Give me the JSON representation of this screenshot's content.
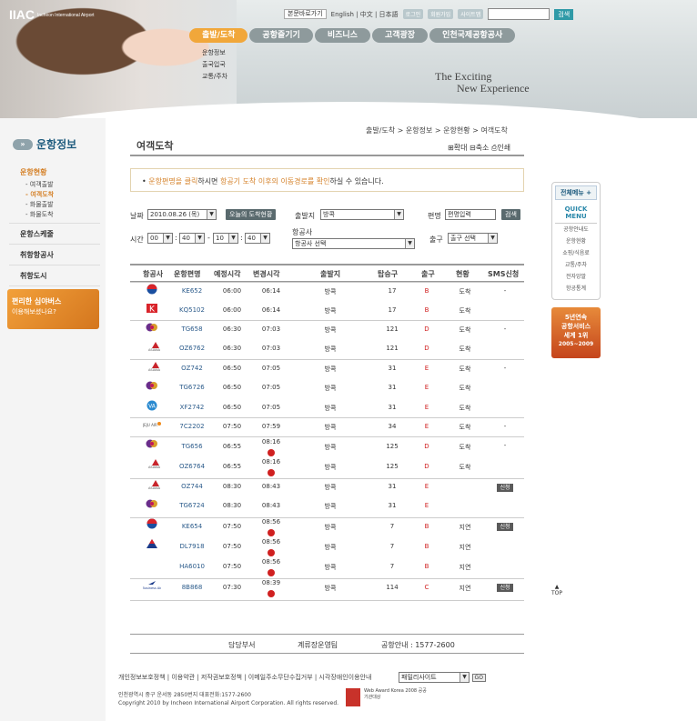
{
  "header": {
    "logo": "IIAC",
    "logo_sub": "Incheon International Airport",
    "quicklinks_select": "본문바로가기",
    "lang": "English | 中文 | 日本語",
    "links": [
      "로그인",
      "회원가입",
      "사이트맵"
    ],
    "search_button": "검색",
    "search_value": ""
  },
  "gnb": {
    "items": [
      "출발/도착",
      "공항즐기기",
      "비즈니스",
      "고객광장",
      "인천국제공항공사"
    ],
    "active": 0,
    "sub_items": [
      "운항정보",
      "출국입국",
      "교통/주차"
    ]
  },
  "slogan": {
    "line1": "The Exciting",
    "line2": "New Experience"
  },
  "lnb": {
    "title": "운항정보",
    "menus": [
      {
        "label": "운항현황",
        "active": true,
        "sub": [
          {
            "label": "- 여객출발",
            "active": false
          },
          {
            "label": "- 여객도착",
            "active": true
          },
          {
            "label": "- 화물출발",
            "active": false
          },
          {
            "label": "- 화물도착",
            "active": false
          }
        ]
      },
      {
        "label": "운항스케줄"
      },
      {
        "label": "취항항공사"
      },
      {
        "label": "취항도시"
      }
    ],
    "banner_title": "편리한 심야버스",
    "banner_sub": "이용해보셨나요?"
  },
  "breadcrumb": "출발/도착 > 운항정보 > 운항현황 > 여객도착",
  "page_title": "여객도착",
  "zoom": {
    "in": "확대",
    "out": "축소",
    "print": "인쇄"
  },
  "notice": {
    "p1": "운항편명을 클릭",
    "p2": "하시면 ",
    "p3": "항공기 도착 이후의 이동경로를 확인",
    "p4": "하실 수 있습니다."
  },
  "filters": {
    "date_label": "날짜",
    "date_value": "2010.08.26 (목)",
    "today_button": "오늘의 도착현황",
    "origin_label": "출발지",
    "origin_value": "방콕",
    "flight_label": "편명",
    "flight_placeholder": "편명입력",
    "search_button": "검색",
    "time_label": "시간",
    "time_from_h": "00",
    "time_from_m": "40",
    "time_to_h": "10",
    "time_to_m": "40",
    "airline_label": "항공사",
    "airline_value": "항공사 선택",
    "exit_label": "출구",
    "exit_value": "출구 선택"
  },
  "table": {
    "headers": [
      "항공사",
      "운항편명",
      "예정시각",
      "변경시각",
      "출발지",
      "탑승구",
      "출구",
      "현황",
      "SMS신청"
    ],
    "rows": [
      {
        "logo": "korean-air-logo",
        "flight": "KE652",
        "sched": "06:00",
        "changed": "06:14",
        "origin": "방콕",
        "gate": "17",
        "exit": "B",
        "status": "도착",
        "sms": "-",
        "changed_icon": false
      },
      {
        "logo": "korean-air-k-logo",
        "flight": "KQ5102",
        "sched": "06:00",
        "changed": "06:14",
        "origin": "방콕",
        "gate": "17",
        "exit": "B",
        "status": "도착",
        "sms": "",
        "changed_icon": false
      },
      {
        "logo": "thai-airways-logo",
        "flight": "TG658",
        "sched": "06:30",
        "changed": "07:03",
        "origin": "방콕",
        "gate": "121",
        "exit": "D",
        "status": "도착",
        "sms": "-",
        "changed_icon": false
      },
      {
        "logo": "asiana-logo",
        "flight": "OZ6762",
        "sched": "06:30",
        "changed": "07:03",
        "origin": "방콕",
        "gate": "121",
        "exit": "D",
        "status": "도착",
        "sms": "",
        "changed_icon": false
      },
      {
        "logo": "asiana-logo",
        "flight": "OZ742",
        "sched": "06:50",
        "changed": "07:05",
        "origin": "방콕",
        "gate": "31",
        "exit": "E",
        "status": "도착",
        "sms": "-",
        "changed_icon": false
      },
      {
        "logo": "thai-airways-logo",
        "flight": "TG6726",
        "sched": "06:50",
        "changed": "07:05",
        "origin": "방콕",
        "gate": "31",
        "exit": "E",
        "status": "도착",
        "sms": "",
        "changed_icon": false
      },
      {
        "logo": "virgin-logo",
        "flight": "XF2742",
        "sched": "06:50",
        "changed": "07:05",
        "origin": "방콕",
        "gate": "31",
        "exit": "E",
        "status": "도착",
        "sms": "",
        "changed_icon": false
      },
      {
        "logo": "jeju-air-logo",
        "flight": "7C2202",
        "sched": "07:50",
        "changed": "07:59",
        "origin": "방콕",
        "gate": "34",
        "exit": "E",
        "status": "도착",
        "sms": "-",
        "changed_icon": false
      },
      {
        "logo": "thai-airways-logo",
        "flight": "TG656",
        "sched": "06:55",
        "changed": "08:16",
        "origin": "방콕",
        "gate": "125",
        "exit": "D",
        "status": "도착",
        "sms": "-",
        "changed_icon": true
      },
      {
        "logo": "asiana-logo",
        "flight": "OZ6764",
        "sched": "06:55",
        "changed": "08:16",
        "origin": "방콕",
        "gate": "125",
        "exit": "D",
        "status": "도착",
        "sms": "",
        "changed_icon": true
      },
      {
        "logo": "asiana-logo",
        "flight": "OZ744",
        "sched": "08:30",
        "changed": "08:43",
        "origin": "방콕",
        "gate": "31",
        "exit": "E",
        "status": "",
        "sms": "신청",
        "changed_icon": false
      },
      {
        "logo": "thai-airways-logo",
        "flight": "TG6724",
        "sched": "08:30",
        "changed": "08:43",
        "origin": "방콕",
        "gate": "31",
        "exit": "E",
        "status": "",
        "sms": "",
        "changed_icon": false
      },
      {
        "logo": "korean-air-logo",
        "flight": "KE654",
        "sched": "07:50",
        "changed": "08:56",
        "origin": "방콕",
        "gate": "7",
        "exit": "B",
        "status": "지연",
        "sms": "신청",
        "changed_icon": true
      },
      {
        "logo": "delta-logo",
        "flight": "DL7918",
        "sched": "07:50",
        "changed": "08:56",
        "origin": "방콕",
        "gate": "7",
        "exit": "B",
        "status": "지연",
        "sms": "",
        "changed_icon": true
      },
      {
        "logo": "",
        "flight": "HA6010",
        "sched": "07:50",
        "changed": "08:56",
        "origin": "방콕",
        "gate": "7",
        "exit": "B",
        "status": "지연",
        "sms": "",
        "changed_icon": true
      },
      {
        "logo": "business-air-logo",
        "flight": "8B868",
        "sched": "07:30",
        "changed": "08:39",
        "origin": "방콕",
        "gate": "114",
        "exit": "C",
        "status": "지연",
        "sms": "신청",
        "changed_icon": true
      }
    ]
  },
  "table_footer": {
    "dept_label": "담당부서",
    "dept": "계류장운영팀",
    "info_label": "공항안내 : 1577-2600"
  },
  "footer": {
    "links": "개인정보보호정책 | 이용약관 | 저작권보호정책 | 이메일주소무단수집거부 | 시각장애인이용안내",
    "family_site": "패밀리사이트",
    "go": "GO",
    "address": "인천광역시 중구 운서동 2850번지    대표전화:1577-2600",
    "copyright": "Copyright 2010  by Incheon International Airport Corporation.  All rights reserved.",
    "award": "Web Award Korea 2008 공공기관대상"
  },
  "quick": {
    "all_menu": "전체메뉴 +",
    "title": "QUICK MENU",
    "items": [
      "공항안내도",
      "운항현황",
      "쇼핑/식음료",
      "교통/주차",
      "전자앙말",
      "항공통계"
    ],
    "award_line1": "5년연속",
    "award_line2": "공항서비스",
    "award_line3": "세계 1위",
    "award_line4": "2005~2009",
    "top": "TOP"
  },
  "colors": {
    "accent": "#f1a73a",
    "gate": "#d02020",
    "nav": "#8e9a9c"
  }
}
